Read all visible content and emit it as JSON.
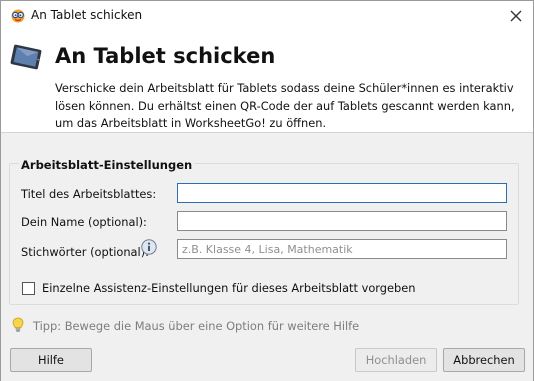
{
  "window": {
    "title": "An Tablet schicken",
    "close_icon": "close-icon",
    "app_icon": "worksheetgo-logo-icon"
  },
  "header": {
    "icon": "tablet-icon",
    "title": "An Tablet schicken",
    "description": "Verschicke dein Arbeitsblatt für Tablets sodass deine Schüler*innen es interaktiv lösen können. Du erhältst einen QR-Code der auf Tablets gescannt werden kann, um das Arbeitsblatt in WorksheetGo! zu öffnen."
  },
  "settings": {
    "group_title": "Arbeitsblatt-Einstellungen",
    "fields": [
      {
        "label": "Titel des Arbeitsblattes:",
        "value": "",
        "placeholder": ""
      },
      {
        "label": "Dein Name (optional):",
        "value": "",
        "placeholder": ""
      },
      {
        "label": "Stichwörter (optional):",
        "value": "",
        "placeholder": "z.B. Klasse 4, Lisa, Mathematik"
      }
    ],
    "info_icon": "info-icon",
    "checkbox": {
      "label": "Einzelne Assistenz-Einstellungen für dieses Arbeitsblatt vorgeben",
      "checked": false
    }
  },
  "tip": {
    "icon": "lightbulb-icon",
    "text": "Tipp: Bewege die Maus über eine Option für weitere Hilfe"
  },
  "buttons": {
    "help": "Hilfe",
    "upload": "Hochladen",
    "cancel": "Abbrechen"
  },
  "colors": {
    "focus_border": "#2a6fb5",
    "content_background": "#f0f0f0",
    "tip_text": "#7d7d7d"
  }
}
